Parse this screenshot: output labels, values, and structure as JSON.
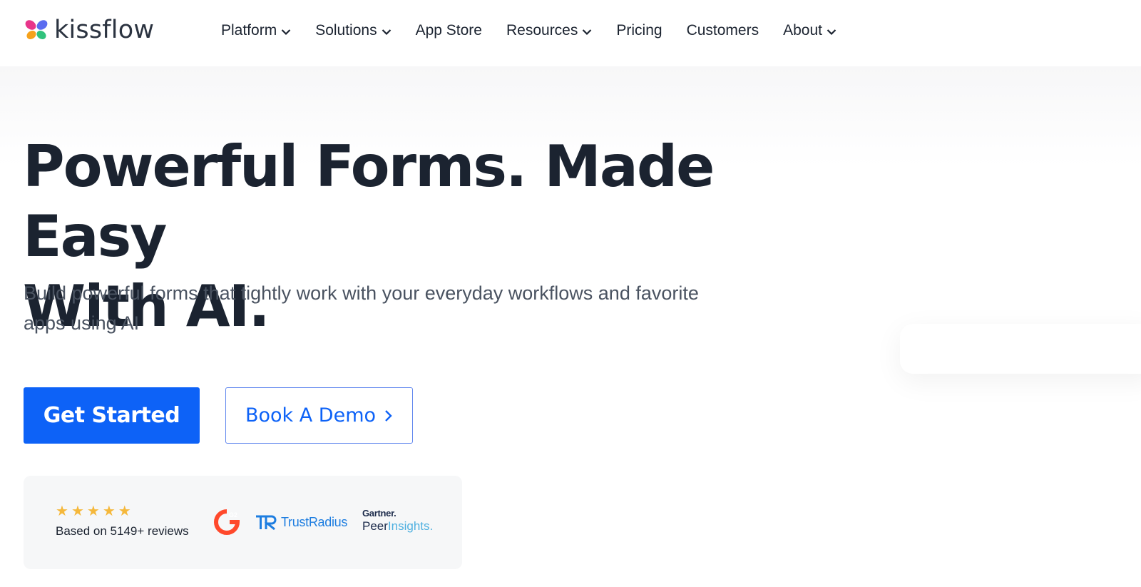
{
  "brand": {
    "name": "kissflow"
  },
  "nav": {
    "items": [
      {
        "label": "Platform",
        "dropdown": true
      },
      {
        "label": "Solutions",
        "dropdown": true
      },
      {
        "label": "App Store",
        "dropdown": false
      },
      {
        "label": "Resources",
        "dropdown": true
      },
      {
        "label": "Pricing",
        "dropdown": false
      },
      {
        "label": "Customers",
        "dropdown": false
      },
      {
        "label": "About",
        "dropdown": true
      }
    ]
  },
  "hero": {
    "headline_line1": "Powerful Forms. Made Easy",
    "headline_line2": "With AI.",
    "subtext_line1": "Build powerful forms that tightly work with your everyday workflows and favorite",
    "subtext_line2": "apps using AI",
    "primary_cta": "Get Started",
    "secondary_cta": "Book A Demo"
  },
  "reviews": {
    "rating_stars": 5,
    "text": "Based on 5149+ reviews",
    "logos": {
      "g2": "G2",
      "trustradius": "TrustRadius",
      "gartner_top": "Gartner.",
      "gartner_peer": "Peer",
      "gartner_insights": "Insights."
    }
  },
  "colors": {
    "primary": "#0d62f7",
    "text_dark": "#1b2330",
    "text_muted": "#4a5361",
    "star": "#f5b83b",
    "g2": "#ff492c",
    "trustradius": "#1d7de0"
  },
  "icons": {
    "dropdown": "chevron-down-icon",
    "cta_arrow": "chevron-right-icon",
    "star": "star-icon"
  }
}
